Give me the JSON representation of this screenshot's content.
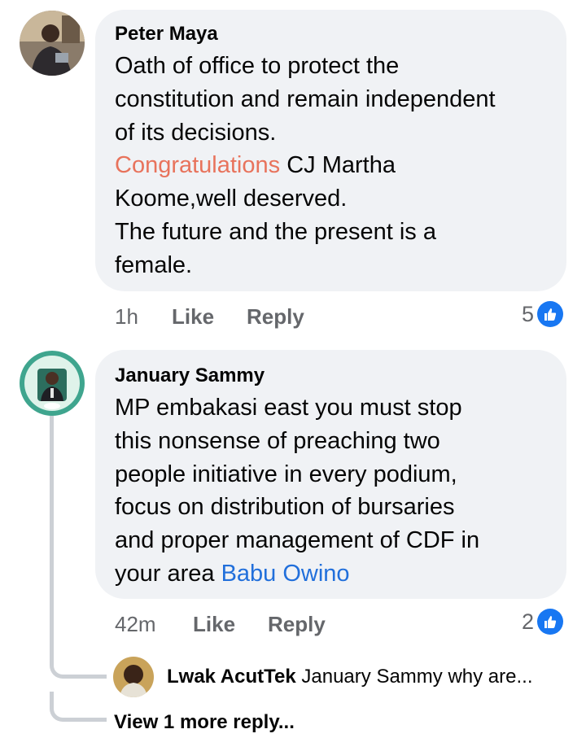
{
  "comments": [
    {
      "author": "Peter Maya",
      "lines": [
        "Oath of office to protect the",
        "constitution and remain independent",
        "of its decisions."
      ],
      "highlight": "Congratulations",
      "line4_rest": " CJ Martha",
      "lines_after": [
        "Koome,well deserved.",
        "The future and the present is a",
        "female."
      ],
      "time": "1h",
      "like_label": "Like",
      "reply_label": "Reply",
      "reaction_count": "5",
      "reaction_icon": "like-thumb-icon",
      "reaction_color": "#1877f2"
    },
    {
      "author": "January Sammy",
      "lines": [
        "MP embakasi east you must stop",
        "this nonsense of preaching two",
        "people initiative in every podium,",
        "focus on distribution of bursaries",
        "and proper management of CDF in"
      ],
      "last_line_prefix": "your area ",
      "mention": "Babu Owino",
      "time": "42m",
      "like_label": "Like",
      "reply_label": "Reply",
      "reaction_count": "2",
      "reaction_icon": "like-thumb-icon",
      "reaction_color": "#1877f2",
      "reply_preview": {
        "author": "Lwak AcutTek",
        "text": "January Sammy why are..."
      },
      "view_more": "View 1 more reply..."
    }
  ],
  "colors": {
    "bubble_bg": "#f0f2f5",
    "meta_text": "#65676b",
    "highlight_text": "#e8735c",
    "mention_link": "#216fdb",
    "thread_line": "#ccd0d5"
  }
}
